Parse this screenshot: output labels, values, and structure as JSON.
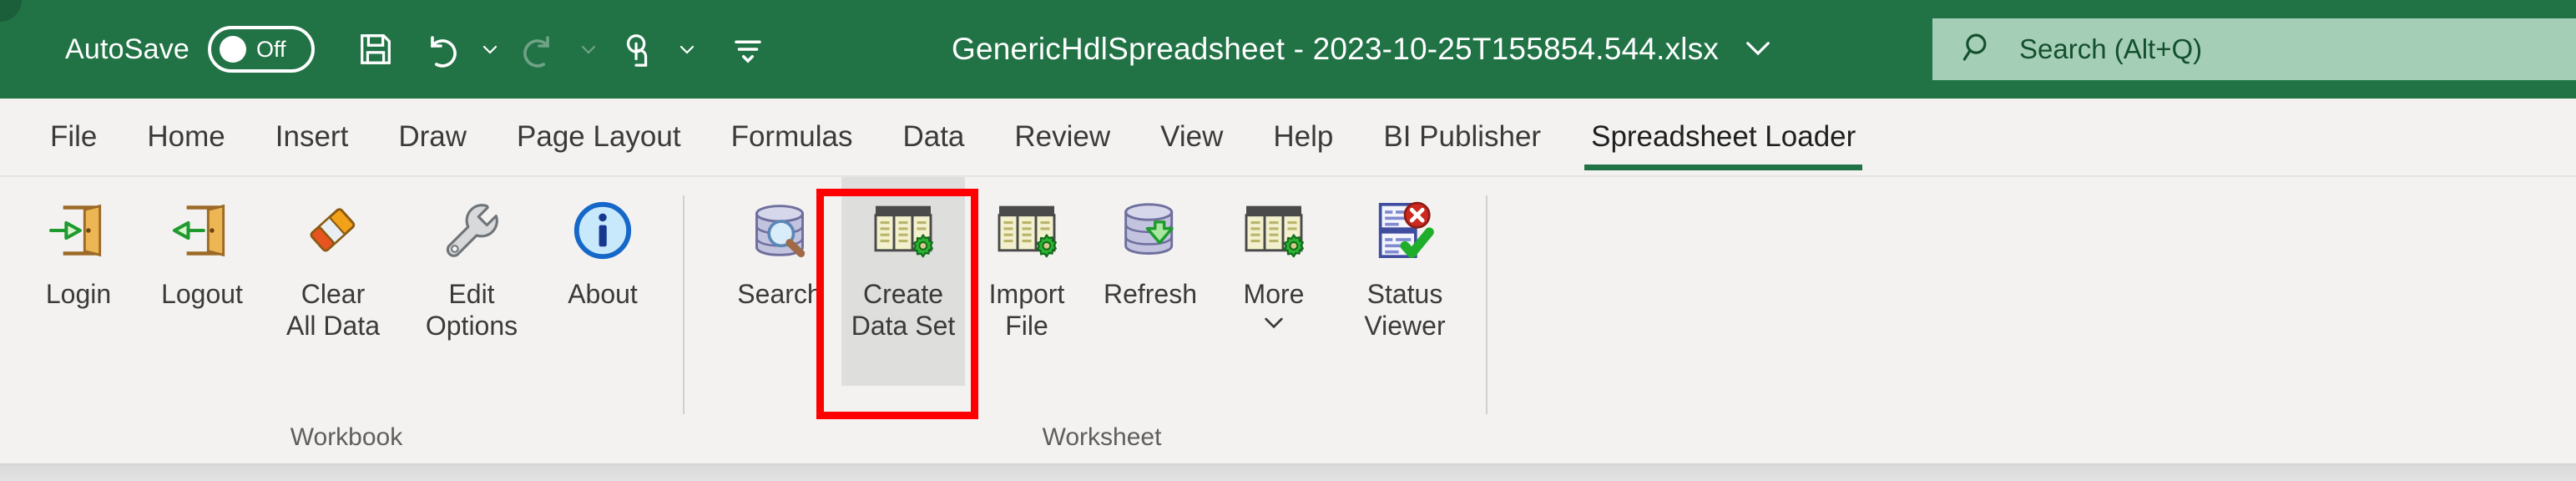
{
  "titlebar": {
    "autosave": {
      "label": "AutoSave",
      "state": "Off",
      "icon": "toggle-off-icon"
    },
    "quick_access": [
      {
        "name": "save-icon",
        "label": "Save"
      },
      {
        "name": "undo-icon",
        "label": "Undo"
      },
      {
        "name": "undo-chevron-down-icon",
        "label": "Undo options"
      },
      {
        "name": "redo-icon",
        "label": "Redo"
      },
      {
        "name": "redo-chevron-down-icon",
        "label": "Redo options"
      },
      {
        "name": "touch-mode-icon",
        "label": "Touch/Mouse Mode"
      },
      {
        "name": "touch-chevron-down-icon",
        "label": "Touch mode options"
      },
      {
        "name": "customize-qat-icon",
        "label": "Customize Quick Access Toolbar"
      }
    ],
    "document_title": "GenericHdlSpreadsheet - 2023-10-25T155854.544.xlsx",
    "title_chevron": "chevron-down-icon",
    "colors": {
      "titlebar_green": "#217346",
      "search_bg": "#a4cfb6",
      "search_text": "#14502f"
    }
  },
  "search": {
    "icon": "search-icon",
    "placeholder": "Search (Alt+Q)"
  },
  "tabs": [
    {
      "label": "File",
      "active": false
    },
    {
      "label": "Home",
      "active": false
    },
    {
      "label": "Insert",
      "active": false
    },
    {
      "label": "Draw",
      "active": false
    },
    {
      "label": "Page Layout",
      "active": false
    },
    {
      "label": "Formulas",
      "active": false
    },
    {
      "label": "Data",
      "active": false
    },
    {
      "label": "Review",
      "active": false
    },
    {
      "label": "View",
      "active": false
    },
    {
      "label": "Help",
      "active": false
    },
    {
      "label": "BI Publisher",
      "active": false
    },
    {
      "label": "Spreadsheet Loader",
      "active": true
    }
  ],
  "ribbon": {
    "groups": [
      {
        "name": "workbook",
        "label": "Workbook",
        "buttons": [
          {
            "line1": "Login",
            "line2": "",
            "icon": "login-door-icon"
          },
          {
            "line1": "Logout",
            "line2": "",
            "icon": "logout-door-icon"
          },
          {
            "line1": "Clear",
            "line2": "All Data",
            "icon": "eraser-icon"
          },
          {
            "line1": "Edit",
            "line2": "Options",
            "icon": "wrench-icon"
          },
          {
            "line1": "About",
            "line2": "",
            "icon": "info-circle-icon"
          }
        ]
      },
      {
        "name": "worksheet",
        "label": "Worksheet",
        "buttons": [
          {
            "line1": "Search",
            "line2": "",
            "icon": "database-search-icon",
            "selected": false
          },
          {
            "line1": "Create",
            "line2": "Data Set",
            "icon": "spreadsheet-gear-icon",
            "selected": true
          },
          {
            "line1": "Import",
            "line2": "File",
            "icon": "spreadsheet-gear-icon",
            "selected": false
          },
          {
            "line1": "Refresh",
            "line2": "",
            "icon": "database-download-icon",
            "selected": false
          },
          {
            "line1": "More",
            "line2": "",
            "icon": "spreadsheet-gear-icon",
            "selected": false,
            "dropdown": "chevron-down-icon"
          },
          {
            "line1": "Status",
            "line2": "Viewer",
            "icon": "status-viewer-icon",
            "selected": false
          }
        ]
      }
    ]
  },
  "annotation": {
    "target": "Create Data Set",
    "color": "#ff0000",
    "shape": "rectangle"
  }
}
